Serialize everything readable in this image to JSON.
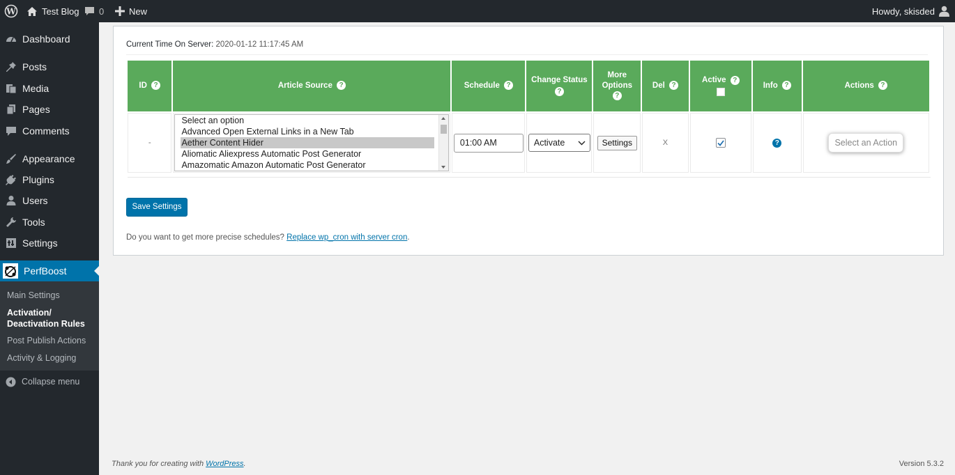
{
  "adminbar": {
    "site_name": "Test Blog",
    "comments_count": "0",
    "new_label": "New",
    "greeting": "Howdy, skisded"
  },
  "sidebar": {
    "items": [
      {
        "label": "Dashboard",
        "icon": "dashboard-icon"
      },
      {
        "label": "Posts",
        "icon": "pin-icon"
      },
      {
        "label": "Media",
        "icon": "media-icon"
      },
      {
        "label": "Pages",
        "icon": "pages-icon"
      },
      {
        "label": "Comments",
        "icon": "comment-icon"
      },
      {
        "label": "Appearance",
        "icon": "brush-icon"
      },
      {
        "label": "Plugins",
        "icon": "plug-icon"
      },
      {
        "label": "Users",
        "icon": "user-icon"
      },
      {
        "label": "Tools",
        "icon": "wrench-icon"
      },
      {
        "label": "Settings",
        "icon": "settings-icon"
      },
      {
        "label": "PerfBoost",
        "icon": "perfboost-icon"
      }
    ],
    "submenu": [
      "Main Settings",
      "Activation/",
      "Deactivation Rules",
      "Post Publish Actions",
      "Activity & Logging"
    ],
    "collapse_label": "Collapse menu"
  },
  "main": {
    "server_time_label": "Current Time On Server:",
    "server_time_value": "2020-01-12 11:17:45 AM",
    "table": {
      "headers": [
        "ID",
        "Article Source",
        "Schedule",
        "Change Status",
        "More Options",
        "Del",
        "Active",
        "Info",
        "Actions"
      ],
      "row": {
        "id": "-",
        "source_options": [
          "Select an option",
          "Advanced Open External Links in a New Tab",
          "Aether Content Hider",
          "Aliomatic Aliexpress Automatic Post Generator",
          "Amazomatic Amazon Automatic Post Generator"
        ],
        "selected_source": "Aether Content Hider",
        "schedule": "01:00 AM",
        "change_status": "Activate",
        "more_options_button": "Settings",
        "del": "X",
        "active": true,
        "action_placeholder": "Select an Action"
      }
    },
    "save_button": "Save Settings",
    "cron_text": "Do you want to get more precise schedules?",
    "cron_link": "Replace wp_cron with server cron",
    "cron_end": "."
  },
  "footer": {
    "thanks_text": "Thank you for creating with",
    "thanks_link": "WordPress",
    "thanks_end": ".",
    "version": "Version 5.3.2"
  },
  "colors": {
    "admin_dark": "#23282d",
    "accent_blue": "#0073aa",
    "header_green": "#5aaa5b"
  }
}
